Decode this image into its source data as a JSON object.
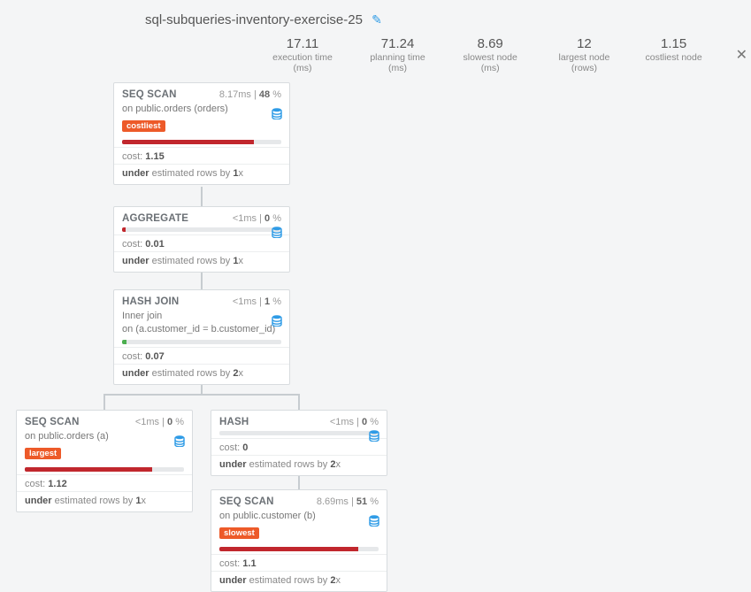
{
  "title": "sql-subqueries-inventory-exercise-25",
  "stats": {
    "exec_time_val": "17.11",
    "exec_time_lbl": "execution time (ms)",
    "plan_time_val": "71.24",
    "plan_time_lbl": "planning time (ms)",
    "slowest_val": "8.69",
    "slowest_lbl": "slowest node (ms)",
    "largest_val": "12",
    "largest_lbl": "largest node (rows)",
    "costliest_val": "1.15",
    "costliest_lbl": "costliest node"
  },
  "nodes": {
    "n1": {
      "name": "SEQ SCAN",
      "timing_ms": "8.17ms",
      "timing_pct": "48",
      "sub_prefix": "on ",
      "sub_main": "public.orders (orders)",
      "tag": "costliest",
      "bar_pct": 83,
      "cost": "1.15",
      "under_prefix": "under",
      "under_mid": " estimated rows by ",
      "under_x": "1",
      "under_suffix": "x"
    },
    "n2": {
      "name": "AGGREGATE",
      "timing_ms": "<1ms",
      "timing_pct": "0",
      "bar_pct": 2,
      "cost": "0.01",
      "under_prefix": "under",
      "under_mid": " estimated rows by ",
      "under_x": "1",
      "under_suffix": "x"
    },
    "n3": {
      "name": "HASH JOIN",
      "timing_ms": "<1ms",
      "timing_pct": "1",
      "sub_line1a": "Inner ",
      "sub_line1b": "join",
      "sub_line2a": "on ",
      "sub_line2b": "(a.customer_id = b.customer_id)",
      "bar_pct": 3,
      "bar_green": true,
      "cost": "0.07",
      "under_prefix": "under",
      "under_mid": " estimated rows by ",
      "under_x": "2",
      "under_suffix": "x"
    },
    "n4": {
      "name": "SEQ SCAN",
      "timing_ms": "<1ms",
      "timing_pct": "0",
      "sub_prefix": "on ",
      "sub_main": "public.orders (a)",
      "tag": "largest",
      "bar_pct": 80,
      "cost": "1.12",
      "under_prefix": "under",
      "under_mid": " estimated rows by ",
      "under_x": "1",
      "under_suffix": "x"
    },
    "n5": {
      "name": "HASH",
      "timing_ms": "<1ms",
      "timing_pct": "0",
      "bar_pct": 0,
      "cost": "0",
      "under_prefix": "under",
      "under_mid": " estimated rows by ",
      "under_x": "2",
      "under_suffix": "x"
    },
    "n6": {
      "name": "SEQ SCAN",
      "timing_ms": "8.69ms",
      "timing_pct": "51",
      "sub_prefix": "on ",
      "sub_main": "public.customer (b)",
      "tag": "slowest",
      "bar_pct": 87,
      "cost": "1.1",
      "under_prefix": "under",
      "under_mid": " estimated rows by ",
      "under_x": "2",
      "under_suffix": "x"
    }
  }
}
